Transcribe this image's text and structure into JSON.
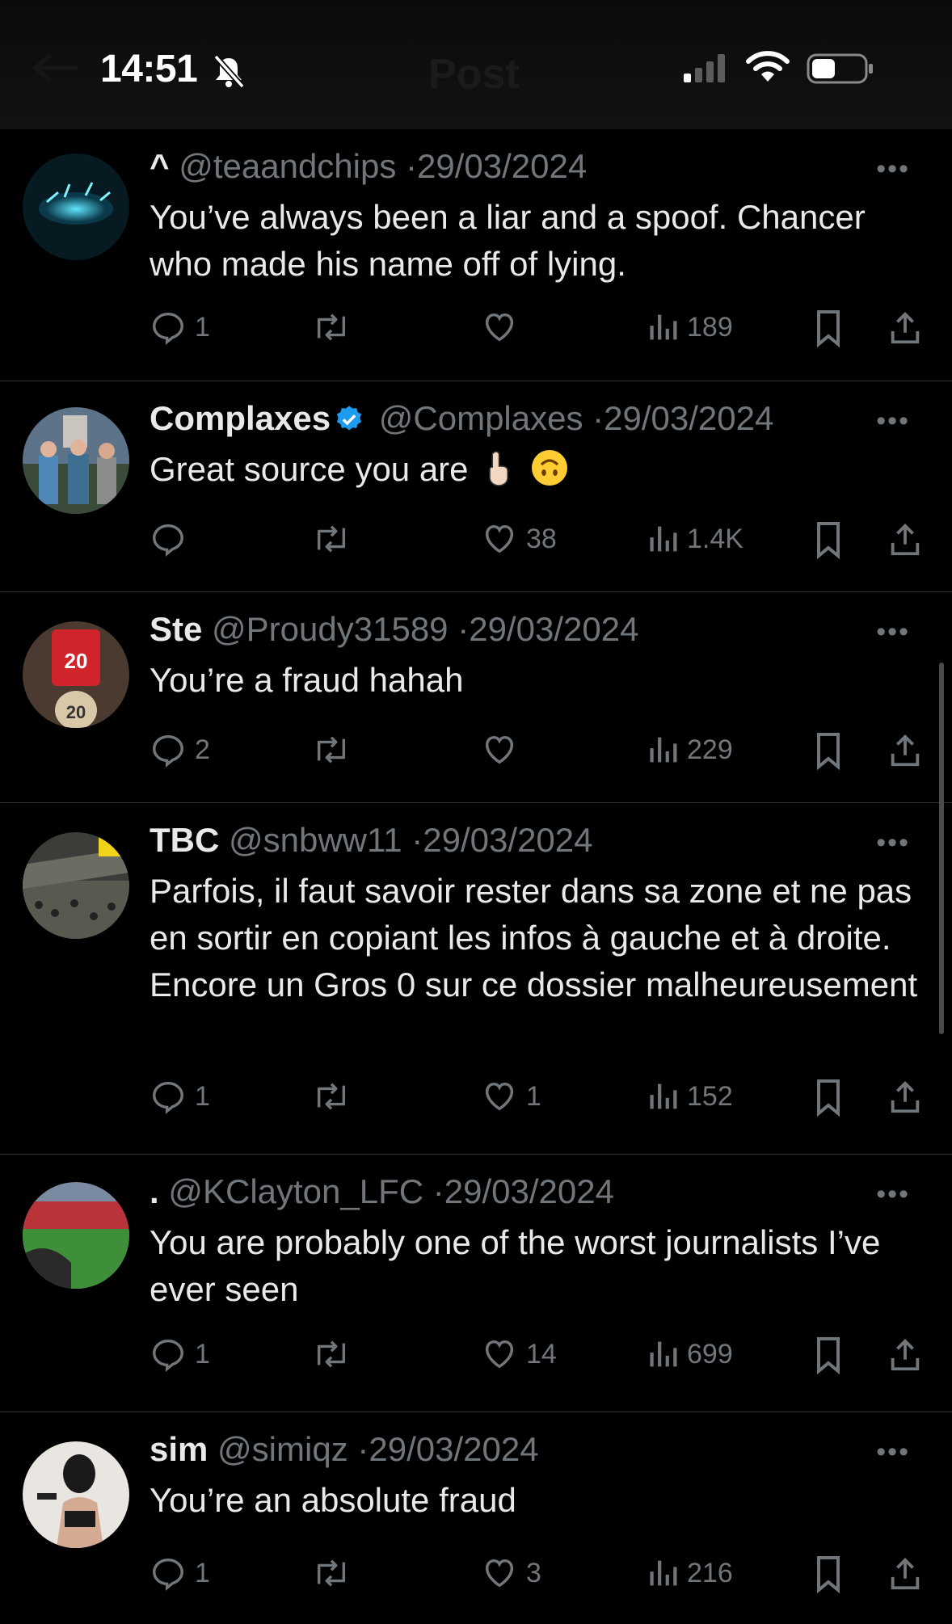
{
  "status_bar": {
    "time": "14:51",
    "ghost_title": "Post"
  },
  "tweets": [
    {
      "display_name": "^",
      "handle": "@teaandchips",
      "date": "29/03/2024",
      "text": "You’ve always been a liar and a spoof. Chancer who made his name off of lying.",
      "replies": "1",
      "retweets": "",
      "likes": "",
      "views": "189",
      "verified": false
    },
    {
      "display_name": "Complaxes",
      "handle": "@Complaxes",
      "date": "29/03/2024",
      "text": "Great source you are",
      "replies": "",
      "retweets": "",
      "likes": "38",
      "views": "1.4K",
      "verified": true
    },
    {
      "display_name": "Ste",
      "handle": "@Proudy31589",
      "date": "29/03/2024",
      "text": "You’re a fraud hahah",
      "replies": "2",
      "retweets": "",
      "likes": "",
      "views": "229",
      "verified": false
    },
    {
      "display_name": "TBC",
      "handle": "@snbww11",
      "date": "29/03/2024",
      "text": "Parfois, il faut savoir rester dans sa zone et ne pas en sortir en copiant les infos à gauche et à droite. Encore un Gros 0 sur ce dossier malheureusement",
      "replies": "1",
      "retweets": "",
      "likes": "1",
      "views": "152",
      "verified": false
    },
    {
      "display_name": ".",
      "handle": "@KClayton_LFC",
      "date": "29/03/2024",
      "text": "You are probably one of the worst journalists I’ve ever seen",
      "replies": "1",
      "retweets": "",
      "likes": "14",
      "views": "699",
      "verified": false
    },
    {
      "display_name": "sim",
      "handle": "@simiqz",
      "date": "29/03/2024",
      "text": "You’re an absolute fraud",
      "replies": "1",
      "retweets": "",
      "likes": "3",
      "views": "216",
      "verified": false
    }
  ],
  "separator": "·",
  "more": "•••",
  "colors": {
    "background": "#000000",
    "text": "#e7e9ea",
    "muted": "#71767b",
    "verified": "#1d9bf0",
    "divider": "#2f3336"
  }
}
